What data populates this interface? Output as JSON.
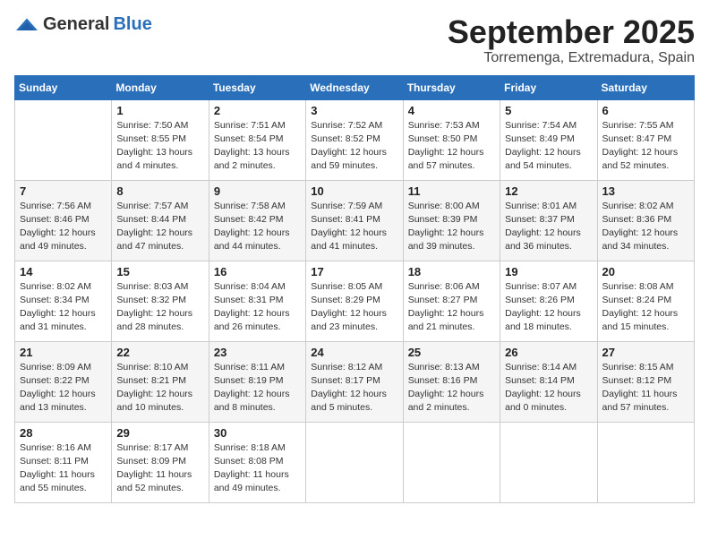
{
  "header": {
    "logo_general": "General",
    "logo_blue": "Blue",
    "month_title": "September 2025",
    "location": "Torremenga, Extremadura, Spain"
  },
  "days_of_week": [
    "Sunday",
    "Monday",
    "Tuesday",
    "Wednesday",
    "Thursday",
    "Friday",
    "Saturday"
  ],
  "weeks": [
    [
      {
        "day": "",
        "info": ""
      },
      {
        "day": "1",
        "info": "Sunrise: 7:50 AM\nSunset: 8:55 PM\nDaylight: 13 hours\nand 4 minutes."
      },
      {
        "day": "2",
        "info": "Sunrise: 7:51 AM\nSunset: 8:54 PM\nDaylight: 13 hours\nand 2 minutes."
      },
      {
        "day": "3",
        "info": "Sunrise: 7:52 AM\nSunset: 8:52 PM\nDaylight: 12 hours\nand 59 minutes."
      },
      {
        "day": "4",
        "info": "Sunrise: 7:53 AM\nSunset: 8:50 PM\nDaylight: 12 hours\nand 57 minutes."
      },
      {
        "day": "5",
        "info": "Sunrise: 7:54 AM\nSunset: 8:49 PM\nDaylight: 12 hours\nand 54 minutes."
      },
      {
        "day": "6",
        "info": "Sunrise: 7:55 AM\nSunset: 8:47 PM\nDaylight: 12 hours\nand 52 minutes."
      }
    ],
    [
      {
        "day": "7",
        "info": "Sunrise: 7:56 AM\nSunset: 8:46 PM\nDaylight: 12 hours\nand 49 minutes."
      },
      {
        "day": "8",
        "info": "Sunrise: 7:57 AM\nSunset: 8:44 PM\nDaylight: 12 hours\nand 47 minutes."
      },
      {
        "day": "9",
        "info": "Sunrise: 7:58 AM\nSunset: 8:42 PM\nDaylight: 12 hours\nand 44 minutes."
      },
      {
        "day": "10",
        "info": "Sunrise: 7:59 AM\nSunset: 8:41 PM\nDaylight: 12 hours\nand 41 minutes."
      },
      {
        "day": "11",
        "info": "Sunrise: 8:00 AM\nSunset: 8:39 PM\nDaylight: 12 hours\nand 39 minutes."
      },
      {
        "day": "12",
        "info": "Sunrise: 8:01 AM\nSunset: 8:37 PM\nDaylight: 12 hours\nand 36 minutes."
      },
      {
        "day": "13",
        "info": "Sunrise: 8:02 AM\nSunset: 8:36 PM\nDaylight: 12 hours\nand 34 minutes."
      }
    ],
    [
      {
        "day": "14",
        "info": "Sunrise: 8:02 AM\nSunset: 8:34 PM\nDaylight: 12 hours\nand 31 minutes."
      },
      {
        "day": "15",
        "info": "Sunrise: 8:03 AM\nSunset: 8:32 PM\nDaylight: 12 hours\nand 28 minutes."
      },
      {
        "day": "16",
        "info": "Sunrise: 8:04 AM\nSunset: 8:31 PM\nDaylight: 12 hours\nand 26 minutes."
      },
      {
        "day": "17",
        "info": "Sunrise: 8:05 AM\nSunset: 8:29 PM\nDaylight: 12 hours\nand 23 minutes."
      },
      {
        "day": "18",
        "info": "Sunrise: 8:06 AM\nSunset: 8:27 PM\nDaylight: 12 hours\nand 21 minutes."
      },
      {
        "day": "19",
        "info": "Sunrise: 8:07 AM\nSunset: 8:26 PM\nDaylight: 12 hours\nand 18 minutes."
      },
      {
        "day": "20",
        "info": "Sunrise: 8:08 AM\nSunset: 8:24 PM\nDaylight: 12 hours\nand 15 minutes."
      }
    ],
    [
      {
        "day": "21",
        "info": "Sunrise: 8:09 AM\nSunset: 8:22 PM\nDaylight: 12 hours\nand 13 minutes."
      },
      {
        "day": "22",
        "info": "Sunrise: 8:10 AM\nSunset: 8:21 PM\nDaylight: 12 hours\nand 10 minutes."
      },
      {
        "day": "23",
        "info": "Sunrise: 8:11 AM\nSunset: 8:19 PM\nDaylight: 12 hours\nand 8 minutes."
      },
      {
        "day": "24",
        "info": "Sunrise: 8:12 AM\nSunset: 8:17 PM\nDaylight: 12 hours\nand 5 minutes."
      },
      {
        "day": "25",
        "info": "Sunrise: 8:13 AM\nSunset: 8:16 PM\nDaylight: 12 hours\nand 2 minutes."
      },
      {
        "day": "26",
        "info": "Sunrise: 8:14 AM\nSunset: 8:14 PM\nDaylight: 12 hours\nand 0 minutes."
      },
      {
        "day": "27",
        "info": "Sunrise: 8:15 AM\nSunset: 8:12 PM\nDaylight: 11 hours\nand 57 minutes."
      }
    ],
    [
      {
        "day": "28",
        "info": "Sunrise: 8:16 AM\nSunset: 8:11 PM\nDaylight: 11 hours\nand 55 minutes."
      },
      {
        "day": "29",
        "info": "Sunrise: 8:17 AM\nSunset: 8:09 PM\nDaylight: 11 hours\nand 52 minutes."
      },
      {
        "day": "30",
        "info": "Sunrise: 8:18 AM\nSunset: 8:08 PM\nDaylight: 11 hours\nand 49 minutes."
      },
      {
        "day": "",
        "info": ""
      },
      {
        "day": "",
        "info": ""
      },
      {
        "day": "",
        "info": ""
      },
      {
        "day": "",
        "info": ""
      }
    ]
  ]
}
